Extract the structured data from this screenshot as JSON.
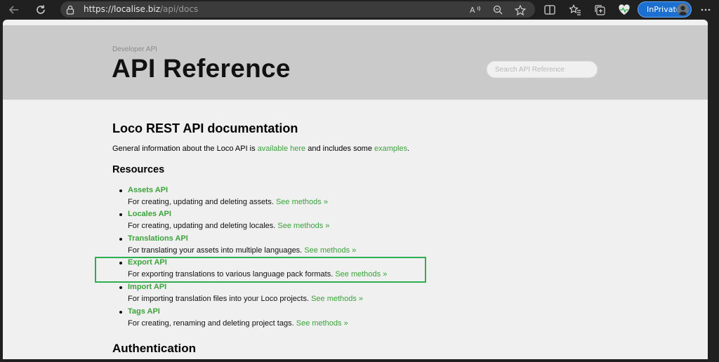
{
  "browser": {
    "url_host": "https://localise.biz",
    "url_path": "/api/docs",
    "inprivate_label": "InPrivate"
  },
  "hero": {
    "eyebrow": "Developer API",
    "title": "API Reference",
    "search_placeholder": "Search API Reference"
  },
  "main": {
    "heading": "Loco REST API documentation",
    "intro_prefix": "General information about the Loco API is ",
    "intro_link1": "available here",
    "intro_middle": " and includes some ",
    "intro_link2": "examples",
    "intro_suffix": ".",
    "resources_heading": "Resources",
    "resources": [
      {
        "name": "Assets API",
        "desc": "For creating, updating and deleting assets. ",
        "link": "See methods »"
      },
      {
        "name": "Locales API",
        "desc": "For creating, updating and deleting locales. ",
        "link": "See methods »"
      },
      {
        "name": "Translations API",
        "desc": "For translating your assets into multiple languages. ",
        "link": "See methods »"
      },
      {
        "name": "Export API",
        "desc": "For exporting translations to various language pack formats. ",
        "link": "See methods »"
      },
      {
        "name": "Import API",
        "desc": "For importing translation files into your Loco projects. ",
        "link": "See methods »"
      },
      {
        "name": "Tags API",
        "desc": "For creating, renaming and deleting project tags. ",
        "link": "See methods »"
      }
    ],
    "auth_heading": "Authentication"
  },
  "colors": {
    "link": "#3aa33a",
    "highlight_border": "#2fae4f",
    "hero_bg": "#cacaca",
    "page_bg": "#f0f0f0",
    "inprivate_bg": "#1a6fd0"
  }
}
